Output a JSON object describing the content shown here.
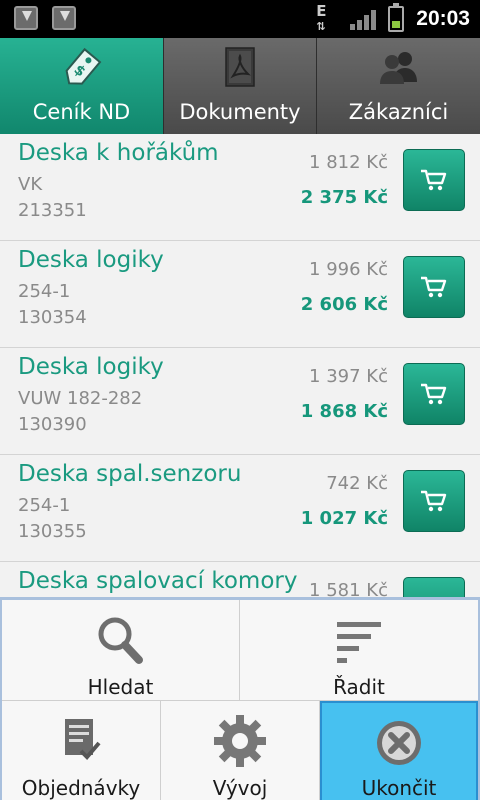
{
  "status_bar": {
    "time": "20:03",
    "network_label": "E"
  },
  "tabs": [
    {
      "label": "Ceník ND",
      "icon": "price-tag-icon",
      "active": true
    },
    {
      "label": "Dokumenty",
      "icon": "pdf-document-icon",
      "active": false
    },
    {
      "label": "Zákazníci",
      "icon": "people-icon",
      "active": false
    }
  ],
  "products": [
    {
      "name": "Deska k hořákům",
      "code1": "VK",
      "code2": "213351",
      "price1": "1 812 Kč",
      "price2": "2 375 Kč"
    },
    {
      "name": "Deska logiky",
      "code1": "254-1",
      "code2": "130354",
      "price1": "1 996 Kč",
      "price2": "2 606 Kč"
    },
    {
      "name": "Deska logiky",
      "code1": "VUW 182-282",
      "code2": "130390",
      "price1": "1 397 Kč",
      "price2": "1 868 Kč"
    },
    {
      "name": "Deska spal.senzoru",
      "code1": "254-1",
      "code2": "130355",
      "price1": "742 Kč",
      "price2": "1 027 Kč"
    },
    {
      "name": "Deska spalovací komory",
      "code1": "",
      "code2": "",
      "price1": "1 581 Kč",
      "price2": ""
    }
  ],
  "menu": {
    "search_label": "Hledat",
    "sort_label": "Řadit",
    "orders_label": "Objednávky",
    "dev_label": "Vývoj",
    "exit_label": "Ukončit"
  },
  "colors": {
    "accent": "#1a9a80",
    "menu_selected": "#47c1f0"
  }
}
